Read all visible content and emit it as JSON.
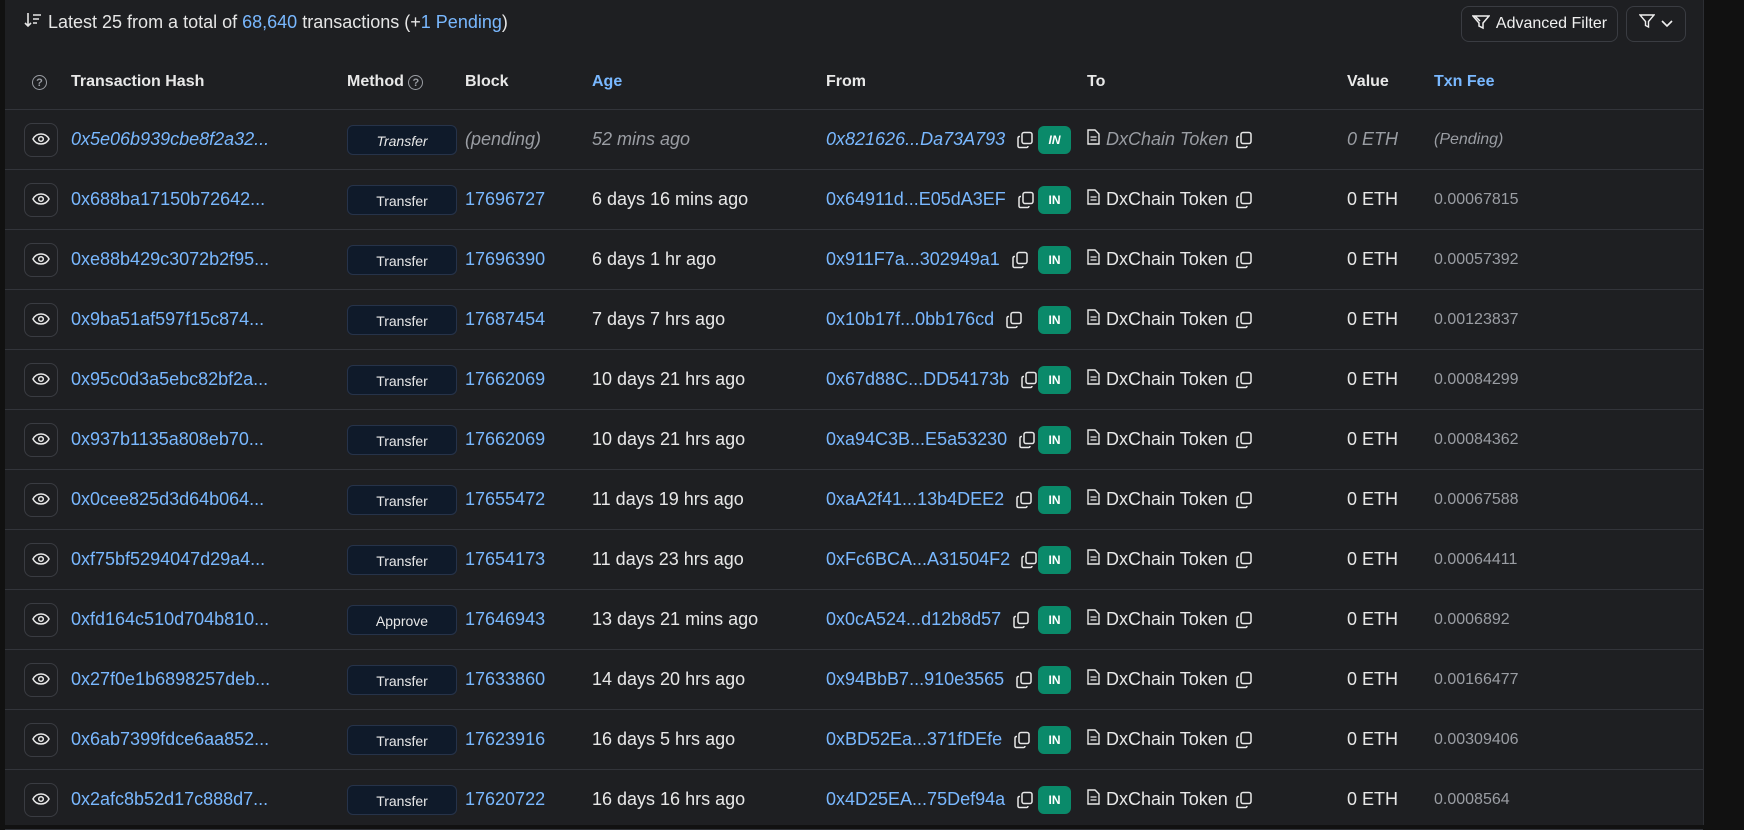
{
  "summary": {
    "prefix": "Latest 25 from a total of",
    "total": "68,640",
    "mid": "transactions (+",
    "pending_count": "1",
    "pending_label": "Pending",
    "suffix": ")"
  },
  "toolbar": {
    "advanced_filter_label": "Advanced Filter"
  },
  "columns": {
    "hash": "Transaction Hash",
    "method": "Method",
    "block": "Block",
    "age": "Age",
    "from": "From",
    "to": "To",
    "value": "Value",
    "fee": "Txn Fee"
  },
  "rows": [
    {
      "hash": "0x5e06b939cbe8f2a32...",
      "method": "Transfer",
      "block": "(pending)",
      "age": "52 mins ago",
      "from": "0x821626...Da73A793",
      "direction": "IN",
      "to": "DxChain Token",
      "value": "0 ETH",
      "fee": "(Pending)",
      "pending": true
    },
    {
      "hash": "0x688ba17150b72642...",
      "method": "Transfer",
      "block": "17696727",
      "age": "6 days 16 mins ago",
      "from": "0x64911d...E05dA3EF",
      "direction": "IN",
      "to": "DxChain Token",
      "value": "0 ETH",
      "fee": "0.00067815"
    },
    {
      "hash": "0xe88b429c3072b2f95...",
      "method": "Transfer",
      "block": "17696390",
      "age": "6 days 1 hr ago",
      "from": "0x911F7a...302949a1",
      "direction": "IN",
      "to": "DxChain Token",
      "value": "0 ETH",
      "fee": "0.00057392"
    },
    {
      "hash": "0x9ba51af597f15c874...",
      "method": "Transfer",
      "block": "17687454",
      "age": "7 days 7 hrs ago",
      "from": "0x10b17f...0bb176cd",
      "direction": "IN",
      "to": "DxChain Token",
      "value": "0 ETH",
      "fee": "0.00123837"
    },
    {
      "hash": "0x95c0d3a5ebc82bf2a...",
      "method": "Transfer",
      "block": "17662069",
      "age": "10 days 21 hrs ago",
      "from": "0x67d88C...DD54173b",
      "direction": "IN",
      "to": "DxChain Token",
      "value": "0 ETH",
      "fee": "0.00084299"
    },
    {
      "hash": "0x937b1135a808eb70...",
      "method": "Transfer",
      "block": "17662069",
      "age": "10 days 21 hrs ago",
      "from": "0xa94C3B...E5a53230",
      "direction": "IN",
      "to": "DxChain Token",
      "value": "0 ETH",
      "fee": "0.00084362"
    },
    {
      "hash": "0x0cee825d3d64b064...",
      "method": "Transfer",
      "block": "17655472",
      "age": "11 days 19 hrs ago",
      "from": "0xaA2f41...13b4DEE2",
      "direction": "IN",
      "to": "DxChain Token",
      "value": "0 ETH",
      "fee": "0.00067588"
    },
    {
      "hash": "0xf75bf5294047d29a4...",
      "method": "Transfer",
      "block": "17654173",
      "age": "11 days 23 hrs ago",
      "from": "0xFc6BCA...A31504F2",
      "direction": "IN",
      "to": "DxChain Token",
      "value": "0 ETH",
      "fee": "0.00064411"
    },
    {
      "hash": "0xfd164c510d704b810...",
      "method": "Approve",
      "block": "17646943",
      "age": "13 days 21 mins ago",
      "from": "0x0cA524...d12b8d57",
      "direction": "IN",
      "to": "DxChain Token",
      "value": "0 ETH",
      "fee": "0.0006892"
    },
    {
      "hash": "0x27f0e1b6898257deb...",
      "method": "Transfer",
      "block": "17633860",
      "age": "14 days 20 hrs ago",
      "from": "0x94BbB7...910e3565",
      "direction": "IN",
      "to": "DxChain Token",
      "value": "0 ETH",
      "fee": "0.00166477"
    },
    {
      "hash": "0x6ab7399fdce6aa852...",
      "method": "Transfer",
      "block": "17623916",
      "age": "16 days 5 hrs ago",
      "from": "0xBD52Ea...371fDEfe",
      "direction": "IN",
      "to": "DxChain Token",
      "value": "0 ETH",
      "fee": "0.00309406"
    },
    {
      "hash": "0x2afc8b52d17c888d7...",
      "method": "Transfer",
      "block": "17620722",
      "age": "16 days 16 hrs ago",
      "from": "0x4D25EA...75Def94a",
      "direction": "IN",
      "to": "DxChain Token",
      "value": "0 ETH",
      "fee": "0.0008564"
    }
  ],
  "colors": {
    "accent": "#79b8ff",
    "in_badge": "#0a8a6a",
    "background": "#1e1f22"
  },
  "icons": {
    "sort": "sort-descending-icon",
    "eye": "eye-icon",
    "copy": "copy-icon",
    "contract": "document-icon",
    "filter": "filter-icon",
    "help": "help-circle-icon"
  }
}
